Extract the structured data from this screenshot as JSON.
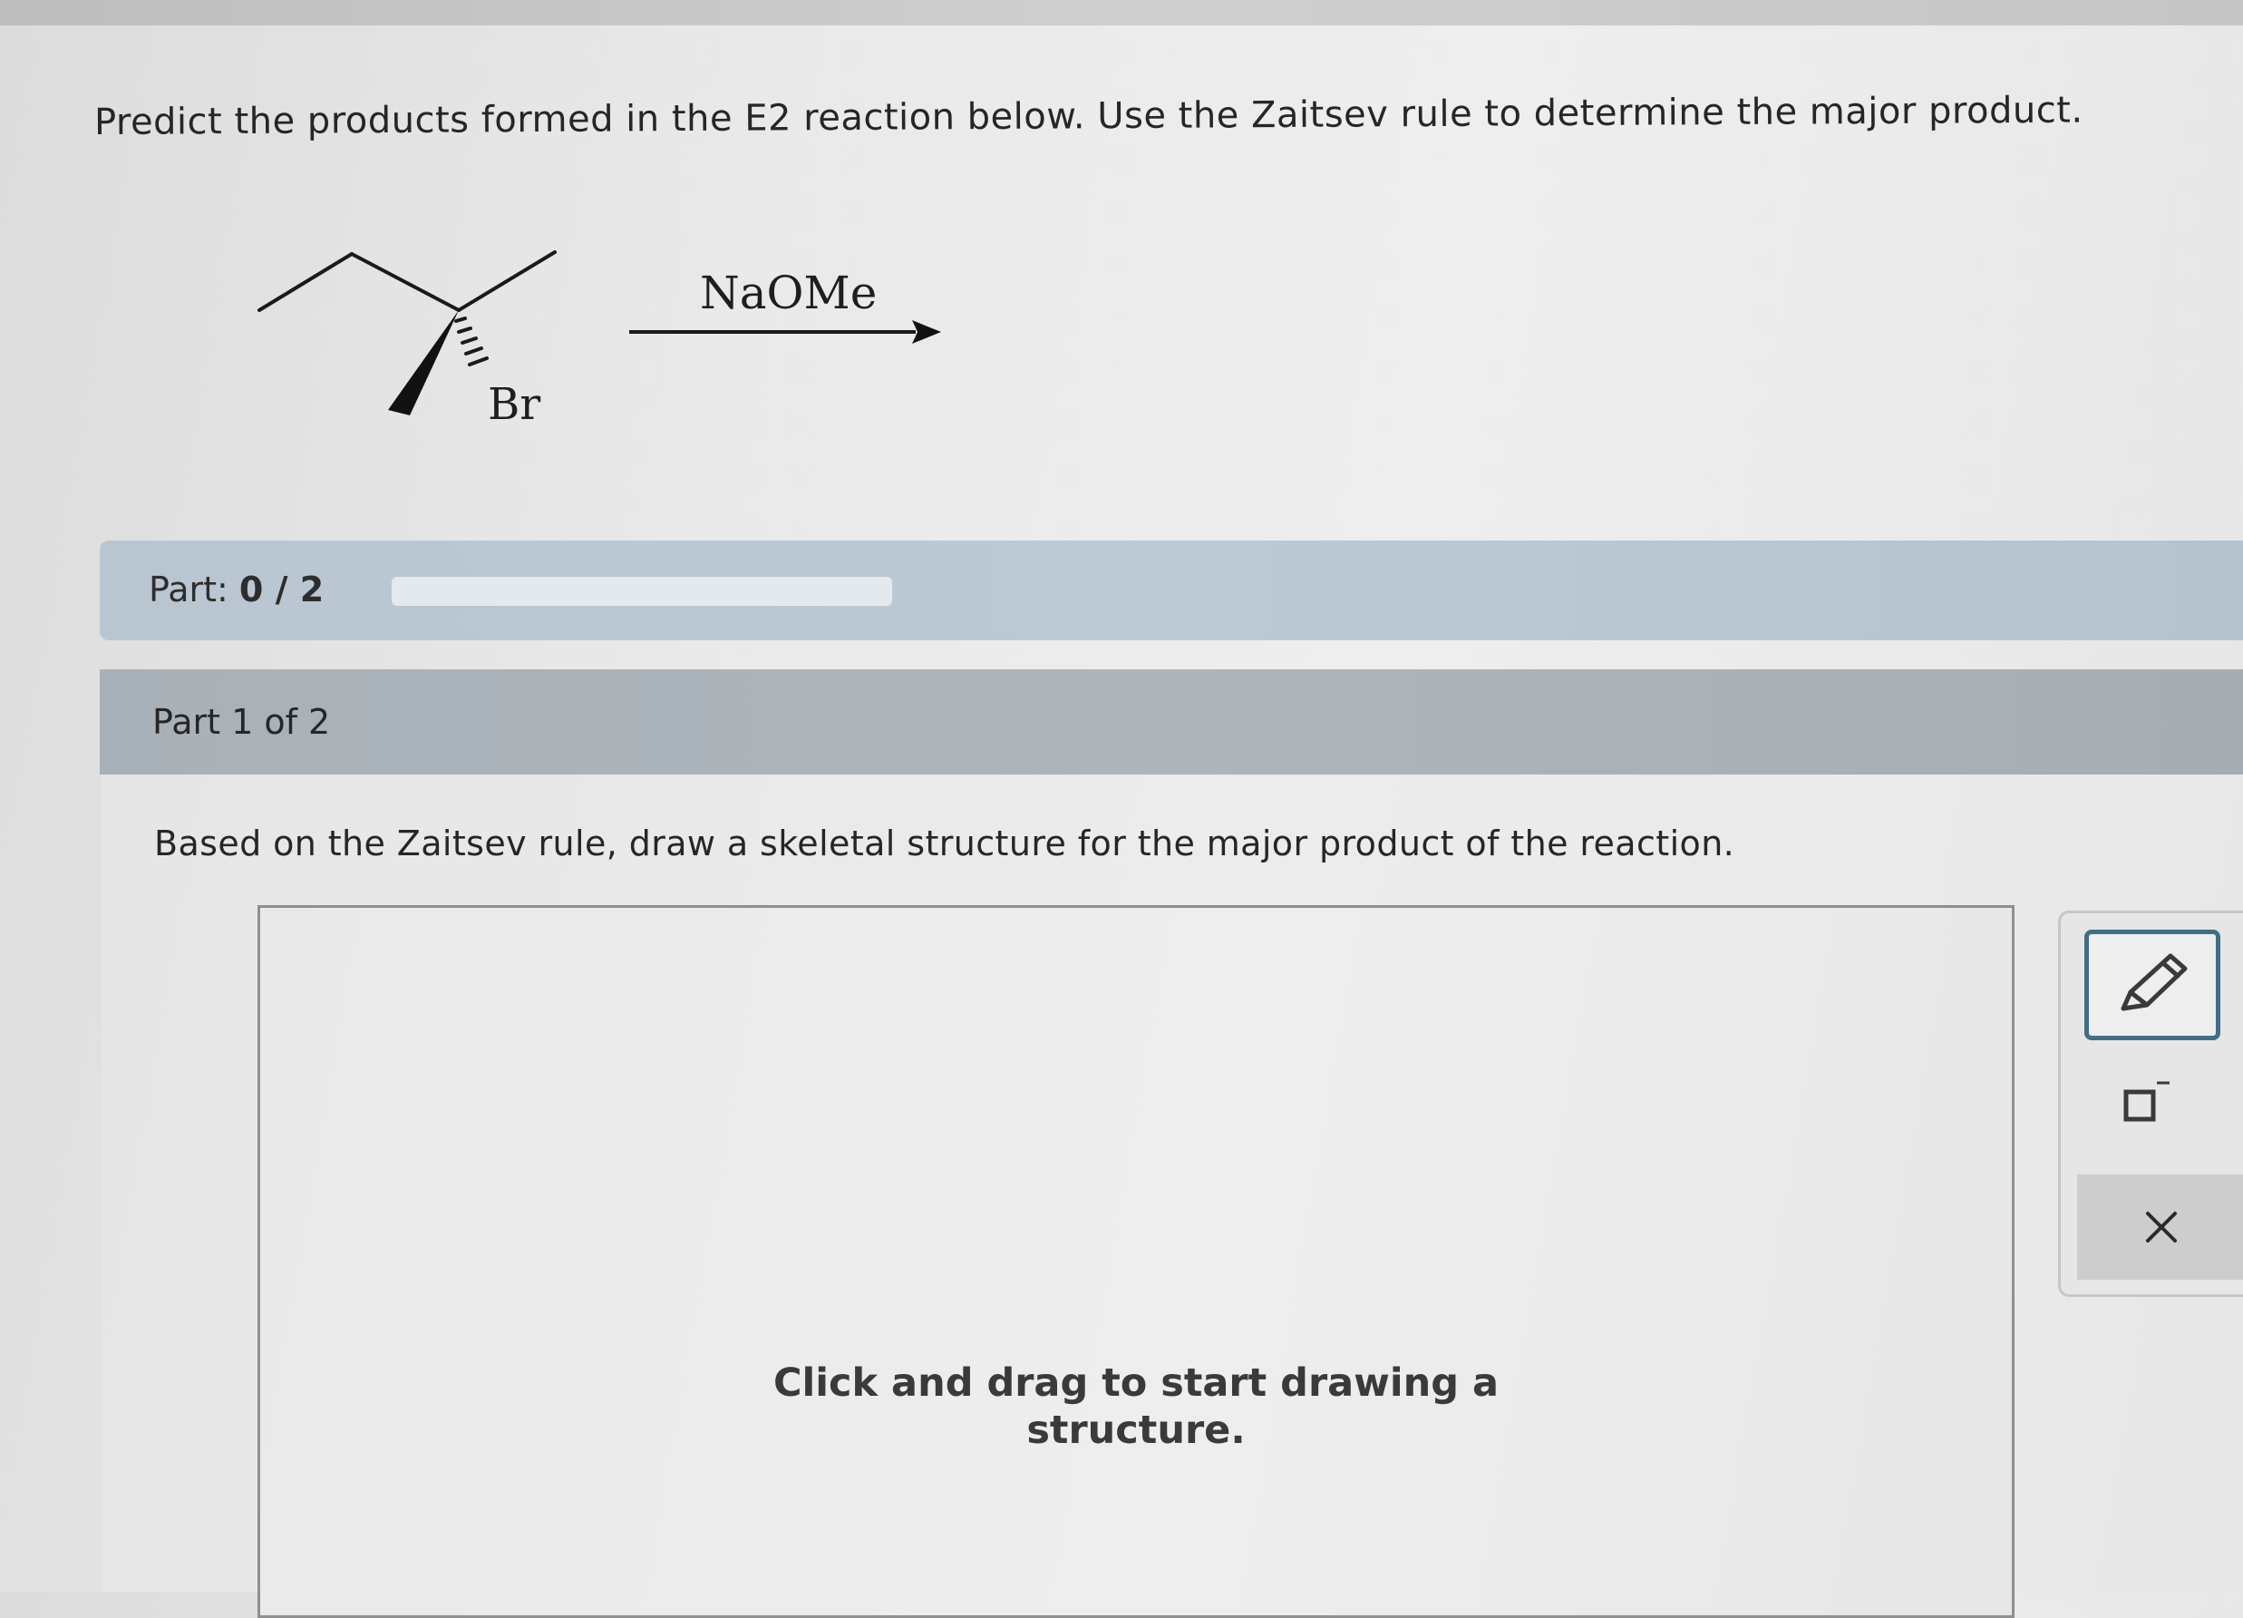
{
  "question": {
    "text": "Predict the products formed in the E2 reaction below. Use the Zaitsev rule to determine the major product."
  },
  "reaction": {
    "reagent": "NaOMe",
    "leaving_group": "Br"
  },
  "progress": {
    "label": "Part: ",
    "current": "0",
    "separator": " / ",
    "total": "2",
    "fraction_complete": 0
  },
  "part": {
    "header": "Part 1 of 2",
    "instruction": "Based on the Zaitsev rule, draw a skeletal structure for the major product of the reaction."
  },
  "canvas": {
    "hint_line1": "Click and drag to start drawing a",
    "hint_line2": "structure."
  },
  "toolbar": {
    "tools": [
      "pencil-icon",
      "erase-icon",
      "close-icon"
    ],
    "accent_color": "#3f6f86"
  }
}
